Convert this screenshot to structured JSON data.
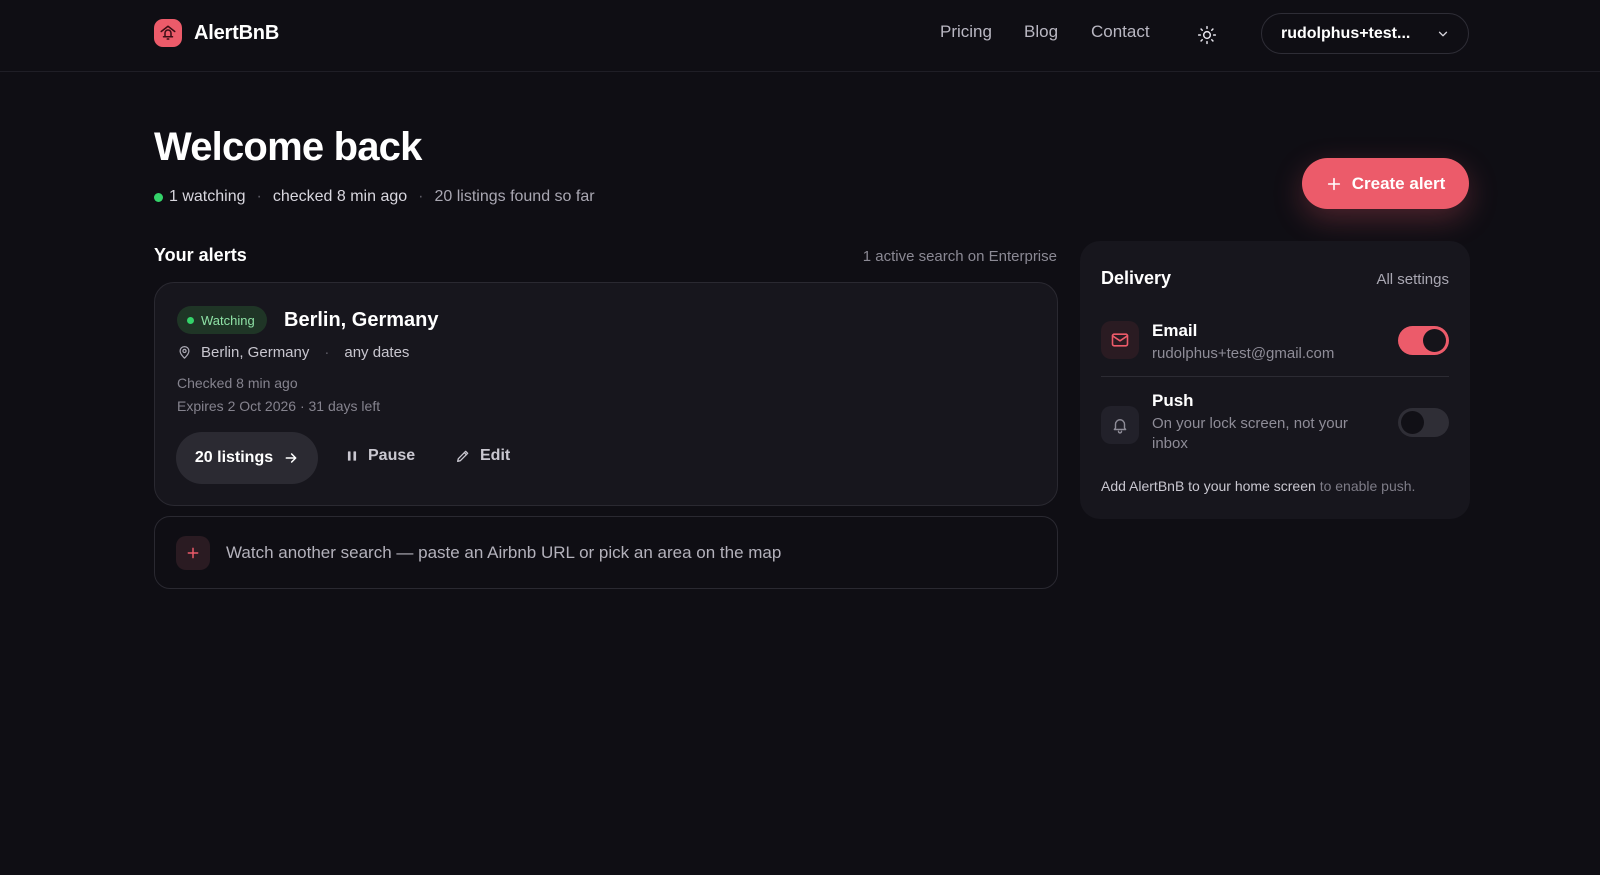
{
  "brand": {
    "name": "AlertBnB",
    "accent": "#ec5b6a"
  },
  "nav": {
    "pricing": "Pricing",
    "blog": "Blog",
    "contact": "Contact"
  },
  "account": {
    "name": "rudolphus+test..."
  },
  "welcome": {
    "title": "Welcome back",
    "watching": "1 watching",
    "checked": "checked 8 min ago",
    "found": "20 listings found so far"
  },
  "create_alert": {
    "label": "Create alert"
  },
  "alerts": {
    "title": "Your alerts",
    "meta": "1 active search on Enterprise",
    "items": [
      {
        "status": "Watching",
        "title": "Berlin, Germany",
        "location": "Berlin, Germany",
        "dates": "any dates",
        "checked": "Checked 8 min ago",
        "expires": "Expires 2 Oct 2026 · 31 days left",
        "listings_label": "20 listings",
        "pause_label": "Pause",
        "edit_label": "Edit"
      }
    ],
    "add_prompt": "Watch another search — paste an Airbnb URL or pick an area on the map"
  },
  "delivery": {
    "title": "Delivery",
    "settings_link": "All settings",
    "email": {
      "name": "Email",
      "detail": "rudolphus+test@gmail.com",
      "enabled": true
    },
    "push": {
      "name": "Push",
      "detail": "On your lock screen, not your inbox",
      "enabled": false
    },
    "note_strong": "Add AlertBnB to your home screen",
    "note_rest": "to enable push."
  }
}
